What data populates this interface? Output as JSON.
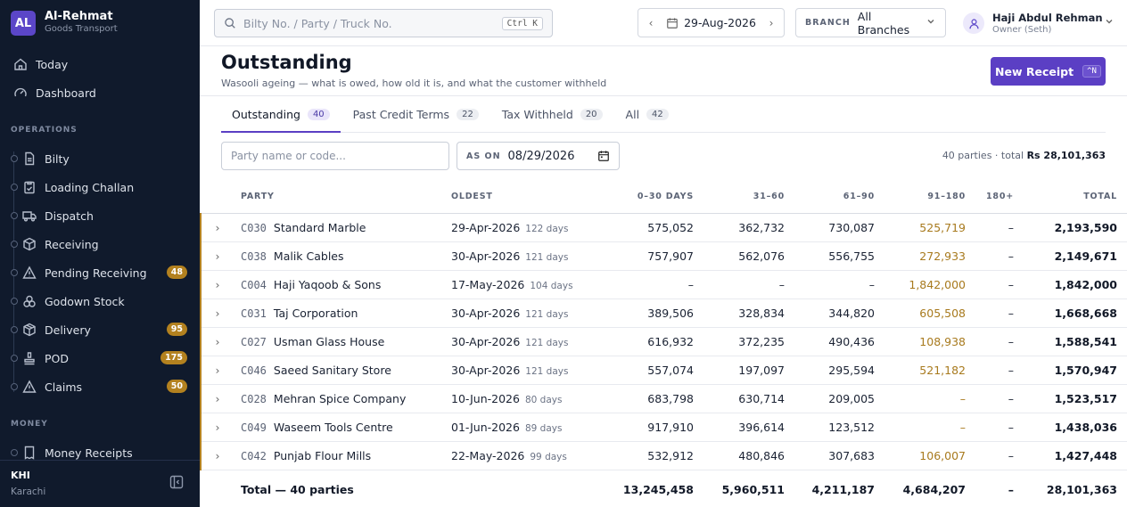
{
  "brand": {
    "logo": "AL",
    "name": "Al-Rehmat",
    "subtitle": "Goods Transport"
  },
  "nav_top": [
    {
      "label": "Today",
      "icon": "home-icon"
    },
    {
      "label": "Dashboard",
      "icon": "gauge-icon"
    }
  ],
  "ops_label": "OPERATIONS",
  "nav_ops": [
    {
      "label": "Bilty",
      "icon": "document-icon",
      "badge": ""
    },
    {
      "label": "Loading Challan",
      "icon": "clipboard-icon",
      "badge": ""
    },
    {
      "label": "Dispatch",
      "icon": "truck-icon",
      "badge": ""
    },
    {
      "label": "Receiving",
      "icon": "box-icon",
      "badge": ""
    },
    {
      "label": "Pending Receiving",
      "icon": "alert-icon",
      "badge": "48"
    },
    {
      "label": "Godown Stock",
      "icon": "stock-icon",
      "badge": ""
    },
    {
      "label": "Delivery",
      "icon": "package-icon",
      "badge": "95"
    },
    {
      "label": "POD",
      "icon": "stamp-icon",
      "badge": "175"
    },
    {
      "label": "Claims",
      "icon": "alert-icon",
      "badge": "50"
    }
  ],
  "money_label": "MONEY",
  "nav_money": [
    {
      "label": "Money Receipts",
      "icon": "receipt-icon"
    }
  ],
  "footer": {
    "branch_code": "KHI",
    "branch_city": "Karachi"
  },
  "topbar": {
    "search_placeholder": "Bilty No. / Party / Truck No.",
    "search_shortcut": "Ctrl K",
    "date": "29-Aug-2026",
    "branch_label": "BRANCH",
    "branch_value": "All Branches",
    "user_name": "Haji Abdul Rehman",
    "user_role": "Owner (Seth)"
  },
  "page": {
    "title": "Outstanding",
    "subtitle": "Wasooli ageing — what is owed, how old it is, and what the customer withheld",
    "new_button": "New Receipt",
    "new_shortcut": "^N"
  },
  "tabs": [
    {
      "label": "Outstanding",
      "count": "40",
      "active": true
    },
    {
      "label": "Past Credit Terms",
      "count": "22",
      "active": false
    },
    {
      "label": "Tax Withheld",
      "count": "20",
      "active": false
    },
    {
      "label": "All",
      "count": "42",
      "active": false
    }
  ],
  "filters": {
    "party_placeholder": "Party name or code...",
    "asof_label": "AS ON",
    "asof_value": "08/29/2026",
    "summary_prefix": "40 parties · total ",
    "summary_total": "Rs 28,101,363"
  },
  "table": {
    "columns": [
      "PARTY",
      "OLDEST",
      "0–30 DAYS",
      "31–60",
      "61–90",
      "91–180",
      "180+",
      "TOTAL"
    ],
    "rows": [
      {
        "code": "C030",
        "name": "Standard Marble",
        "date": "29-Apr-2026",
        "days": "122 days",
        "d0": "575,052",
        "d31": "362,732",
        "d61": "730,087",
        "d91": "525,719",
        "d180": "–",
        "total": "2,193,590"
      },
      {
        "code": "C038",
        "name": "Malik Cables",
        "date": "30-Apr-2026",
        "days": "121 days",
        "d0": "757,907",
        "d31": "562,076",
        "d61": "556,755",
        "d91": "272,933",
        "d180": "–",
        "total": "2,149,671"
      },
      {
        "code": "C004",
        "name": "Haji Yaqoob & Sons",
        "date": "17-May-2026",
        "days": "104 days",
        "d0": "–",
        "d31": "–",
        "d61": "–",
        "d91": "1,842,000",
        "d180": "–",
        "total": "1,842,000"
      },
      {
        "code": "C031",
        "name": "Taj Corporation",
        "date": "30-Apr-2026",
        "days": "121 days",
        "d0": "389,506",
        "d31": "328,834",
        "d61": "344,820",
        "d91": "605,508",
        "d180": "–",
        "total": "1,668,668"
      },
      {
        "code": "C027",
        "name": "Usman Glass House",
        "date": "30-Apr-2026",
        "days": "121 days",
        "d0": "616,932",
        "d31": "372,235",
        "d61": "490,436",
        "d91": "108,938",
        "d180": "–",
        "total": "1,588,541"
      },
      {
        "code": "C046",
        "name": "Saeed Sanitary Store",
        "date": "30-Apr-2026",
        "days": "121 days",
        "d0": "557,074",
        "d31": "197,097",
        "d61": "295,594",
        "d91": "521,182",
        "d180": "–",
        "total": "1,570,947"
      },
      {
        "code": "C028",
        "name": "Mehran Spice Company",
        "date": "10-Jun-2026",
        "days": "80 days",
        "d0": "683,798",
        "d31": "630,714",
        "d61": "209,005",
        "d91": "–",
        "d180": "–",
        "total": "1,523,517"
      },
      {
        "code": "C049",
        "name": "Waseem Tools Centre",
        "date": "01-Jun-2026",
        "days": "89 days",
        "d0": "917,910",
        "d31": "396,614",
        "d61": "123,512",
        "d91": "–",
        "d180": "–",
        "total": "1,438,036"
      },
      {
        "code": "C042",
        "name": "Punjab Flour Mills",
        "date": "22-May-2026",
        "days": "99 days",
        "d0": "532,912",
        "d31": "480,846",
        "d61": "307,683",
        "d91": "106,007",
        "d180": "–",
        "total": "1,427,448"
      }
    ],
    "total_row": {
      "label": "Total — 40 parties",
      "d0": "13,245,458",
      "d31": "5,960,511",
      "d61": "4,211,187",
      "d91": "4,684,207",
      "d180": "–",
      "total": "28,101,363"
    }
  },
  "colors": {
    "accent": "#5b3fc4",
    "sidebar_bg": "#101a2c",
    "badge": "#b3811f",
    "aged": "#a87a1e"
  }
}
